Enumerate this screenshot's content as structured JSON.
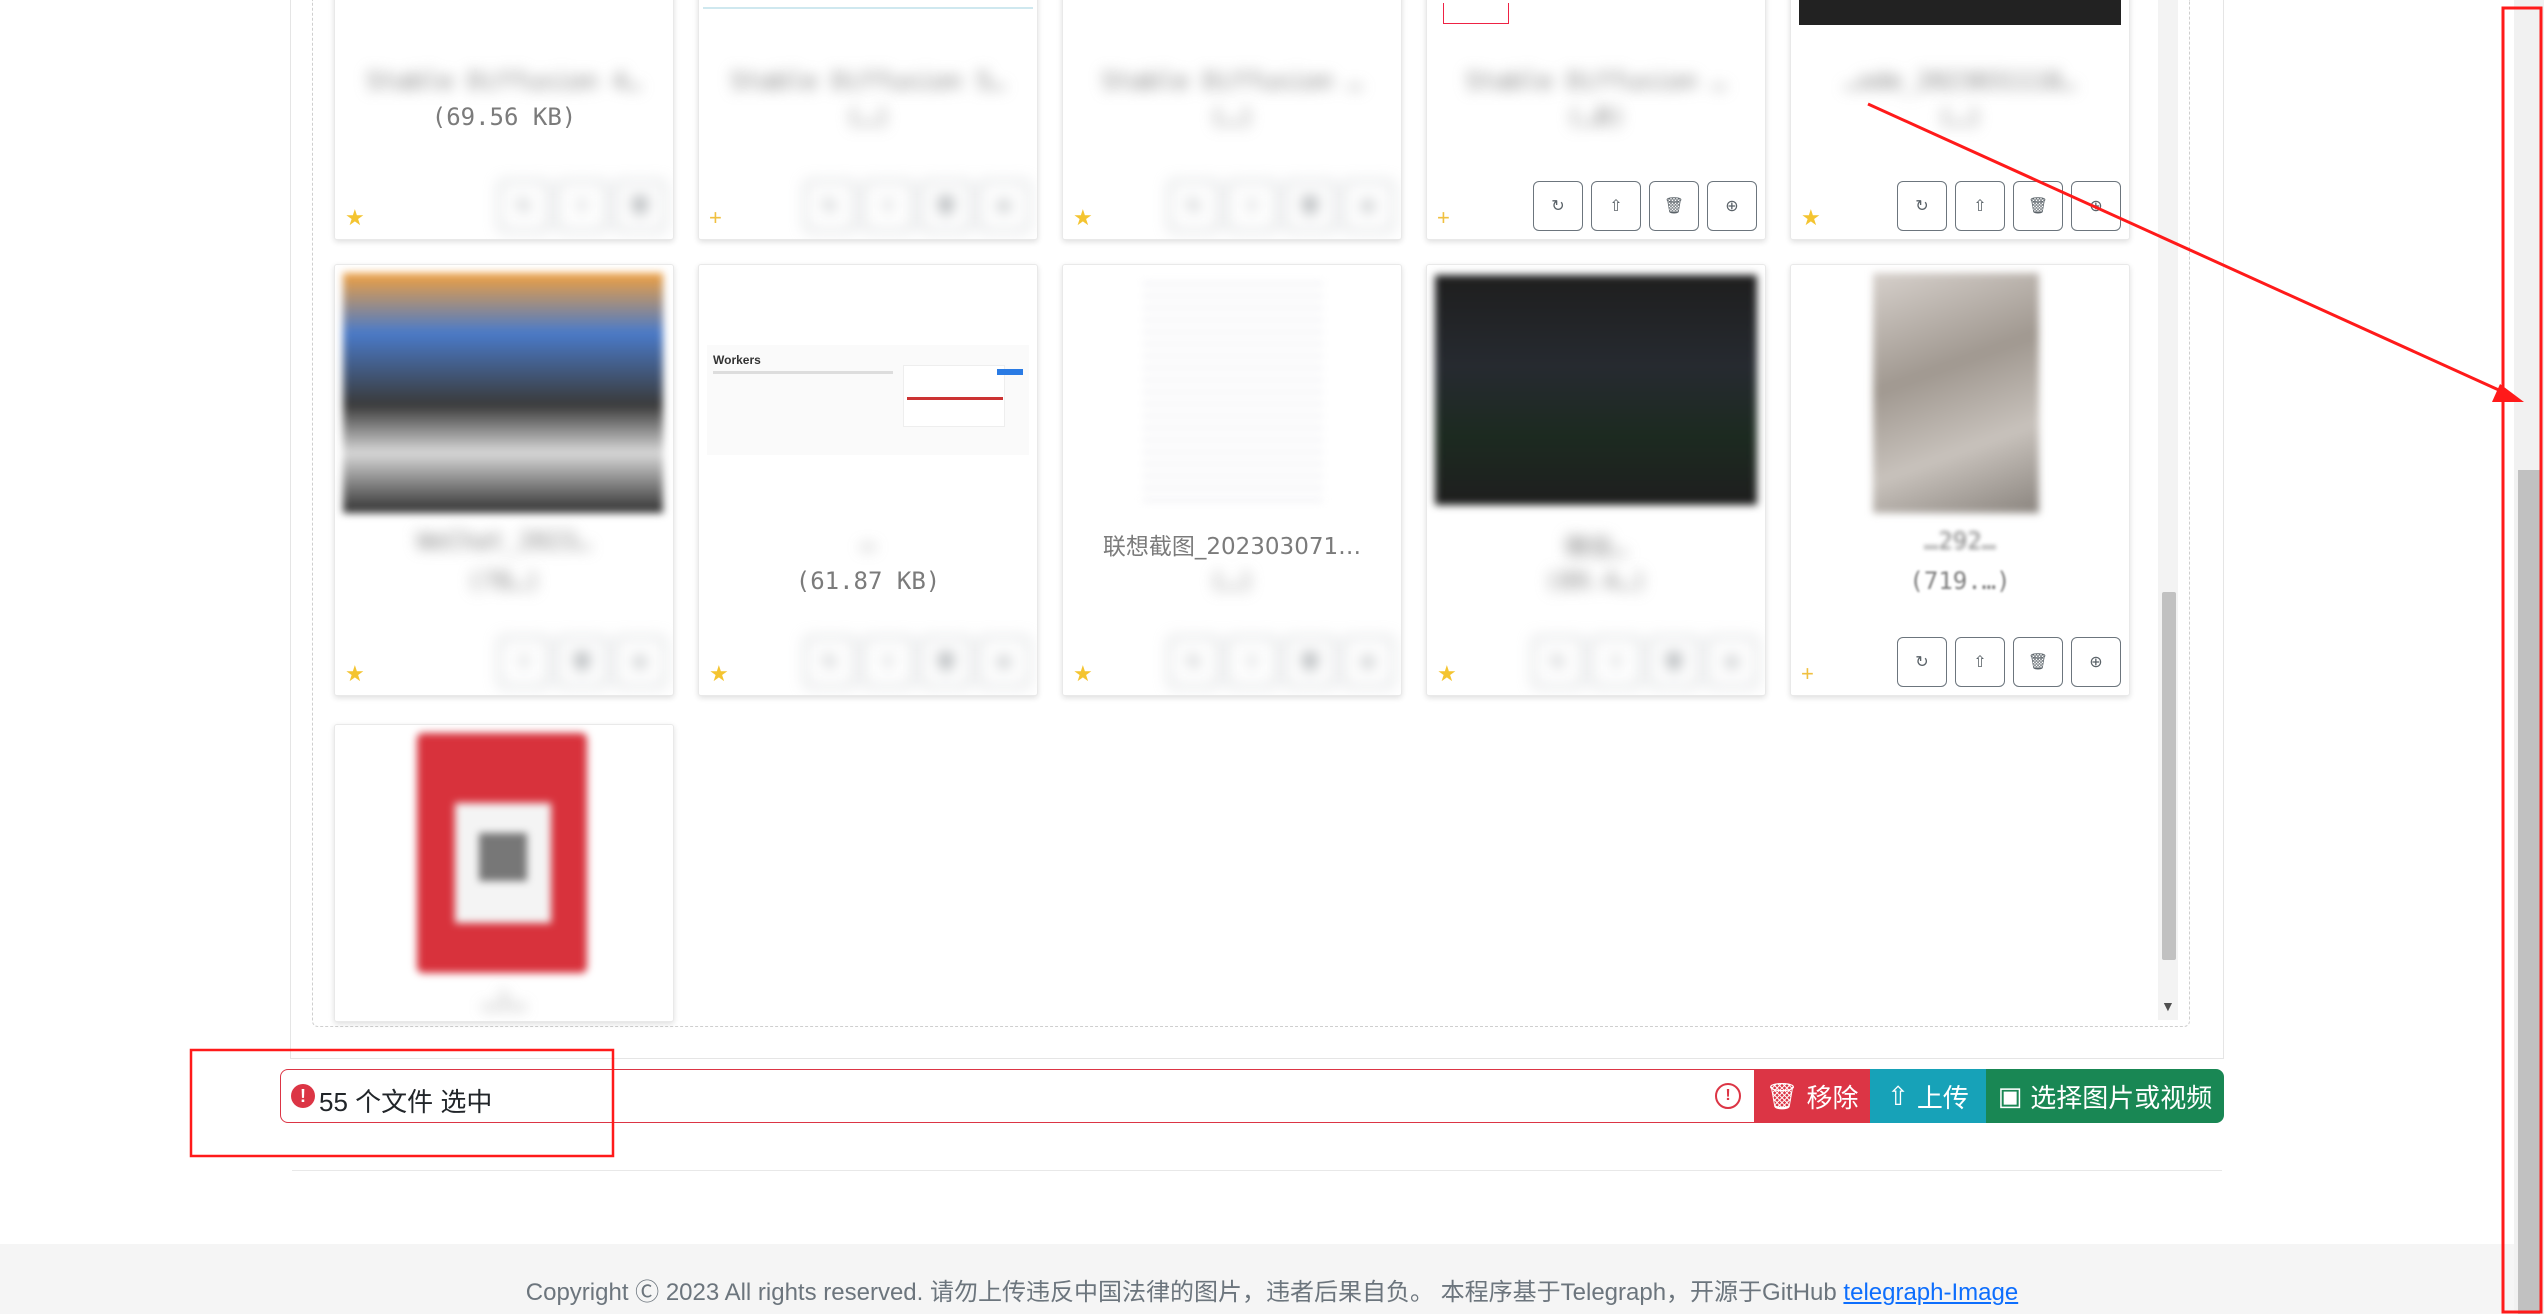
{
  "grid": {
    "row1": [
      {
        "name": "Stable Diffusion 4…",
        "size": "(69.56 KB)"
      },
      {
        "name": "Stable Diffusion 5…",
        "size": "(…)"
      },
      {
        "name": "Stable Diffusion …",
        "size": "(…)"
      },
      {
        "name": "Stable Diffusion …",
        "size": "(…B)"
      },
      {
        "name": "…ode_2023031118…",
        "size": "(…)"
      }
    ],
    "row2": [
      {
        "name": "WeChat_2023…",
        "size": "(78…)"
      },
      {
        "name": "…",
        "size": "(61.87 KB)"
      },
      {
        "name": "联想截图_202303071…",
        "size": "(…)"
      },
      {
        "name": "微信…",
        "size": "(89.4…)"
      },
      {
        "name": "…292…",
        "size": "(719.…)"
      }
    ],
    "row3": [
      {
        "name": "…)…",
        "size": ""
      }
    ],
    "workers_title": "Workers"
  },
  "upload_bar": {
    "selection_text": "55 个文件 选中",
    "remove_label": "移除",
    "upload_label": "上传",
    "choose_label": "选择图片或视频"
  },
  "footer": {
    "text": "Copyright Ⓒ 2023 All rights reserved. 请勿上传违反中国法律的图片，违者后果自负。 本程序基于Telegraph，开源于GitHub",
    "link_text": "telegraph-Image"
  },
  "colors": {
    "danger": "#dc3545",
    "info": "#17a2b8",
    "success": "#198754",
    "link": "#0d6efd",
    "annotation": "#ff1a1a"
  }
}
